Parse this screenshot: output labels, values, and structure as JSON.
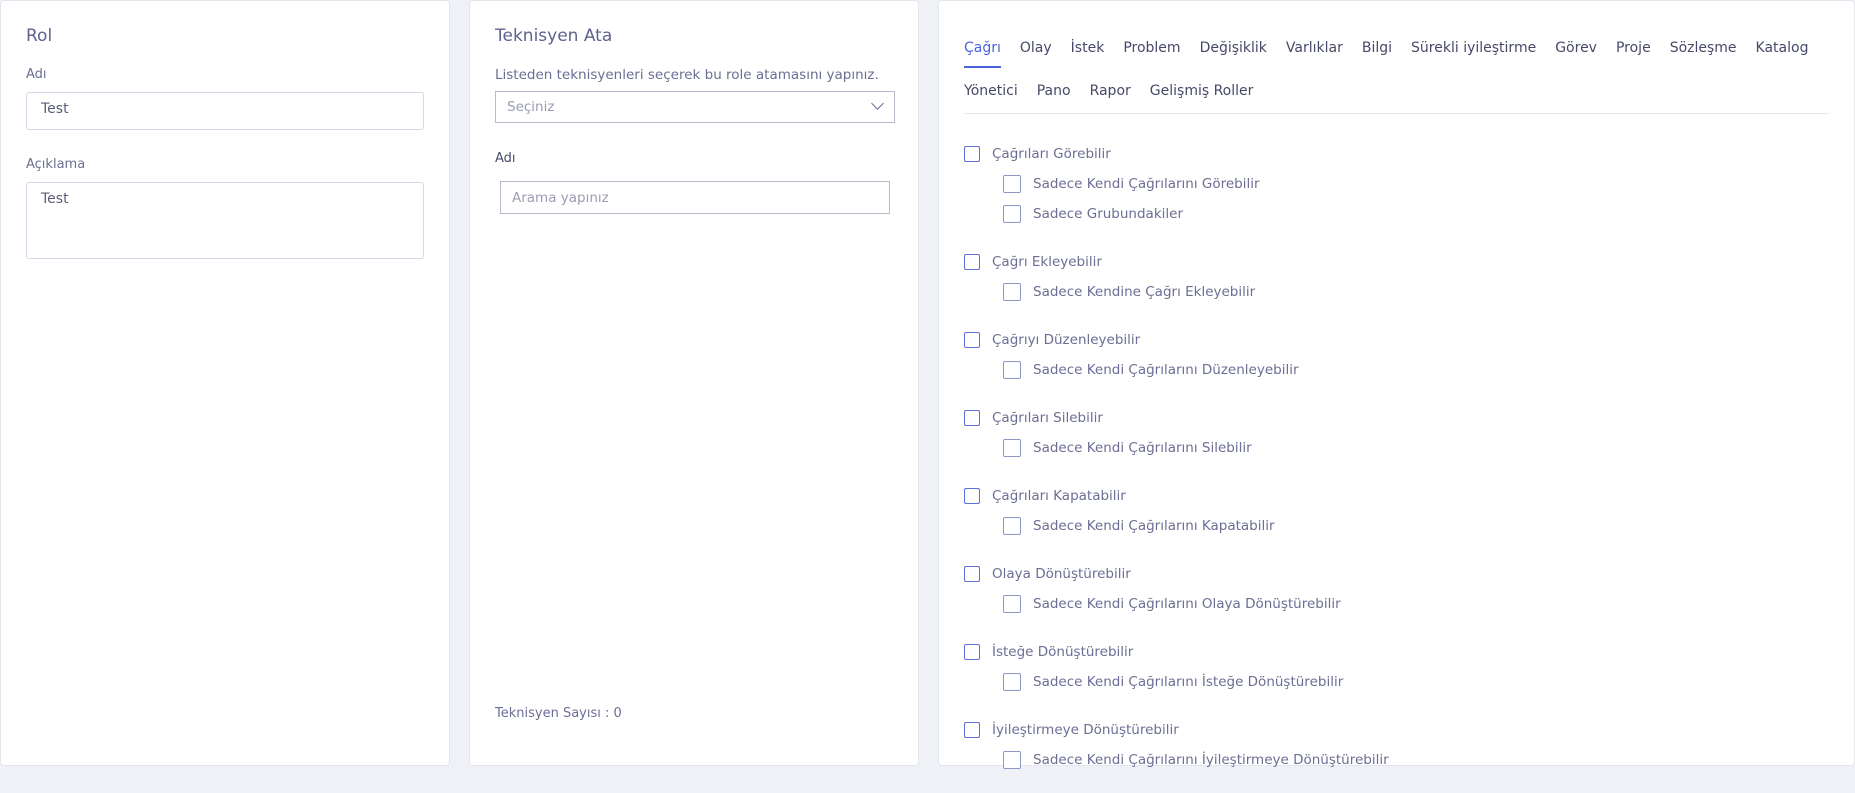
{
  "role_card": {
    "title": "Rol",
    "name_label": "Adı",
    "name_value": "Test",
    "description_label": "Açıklama",
    "description_value": "Test"
  },
  "tech_card": {
    "title": "Teknisyen Ata",
    "help_text": "Listeden teknisyenleri seçerek bu role atamasını yapınız.",
    "select_value": "Seçiniz",
    "name_label": "Adı",
    "search_placeholder": "Arama yapınız",
    "count_text": "Teknisyen Sayısı : 0"
  },
  "tabs_row1": [
    {
      "label": "Çağrı",
      "active": true
    },
    {
      "label": "Olay"
    },
    {
      "label": "İstek"
    },
    {
      "label": "Problem"
    },
    {
      "label": "Değişiklik"
    },
    {
      "label": "Varlıklar"
    },
    {
      "label": "Bilgi"
    },
    {
      "label": "Sürekli iyileştirme"
    },
    {
      "label": "Görev"
    },
    {
      "label": "Proje"
    },
    {
      "label": "Sözleşme"
    },
    {
      "label": "Katalog"
    }
  ],
  "tabs_row2": [
    {
      "label": "Yönetici"
    },
    {
      "label": "Pano"
    },
    {
      "label": "Rapor"
    },
    {
      "label": "Gelişmiş Roller"
    }
  ],
  "permissions": [
    {
      "label": "Çağrıları Görebilir",
      "subs": [
        "Sadece Kendi Çağrılarını Görebilir",
        "Sadece Grubundakiler"
      ]
    },
    {
      "label": "Çağrı Ekleyebilir",
      "subs": [
        "Sadece Kendine Çağrı Ekleyebilir"
      ]
    },
    {
      "label": "Çağrıyı Düzenleyebilir",
      "subs": [
        "Sadece Kendi Çağrılarını Düzenleyebilir"
      ]
    },
    {
      "label": "Çağrıları Silebilir",
      "subs": [
        "Sadece Kendi Çağrılarını Silebilir"
      ]
    },
    {
      "label": "Çağrıları Kapatabilir",
      "subs": [
        "Sadece Kendi Çağrılarını Kapatabilir"
      ]
    },
    {
      "label": "Olaya Dönüştürebilir",
      "subs": [
        "Sadece Kendi Çağrılarını Olaya Dönüştürebilir"
      ]
    },
    {
      "label": "İsteğe Dönüştürebilir",
      "subs": [
        "Sadece Kendi Çağrılarını İsteğe Dönüştürebilir"
      ]
    },
    {
      "label": "İyileştirmeye Dönüştürebilir",
      "subs": [
        "Sadece Kendi Çağrılarını İyileştirmeye Dönüştürebilir"
      ]
    }
  ]
}
